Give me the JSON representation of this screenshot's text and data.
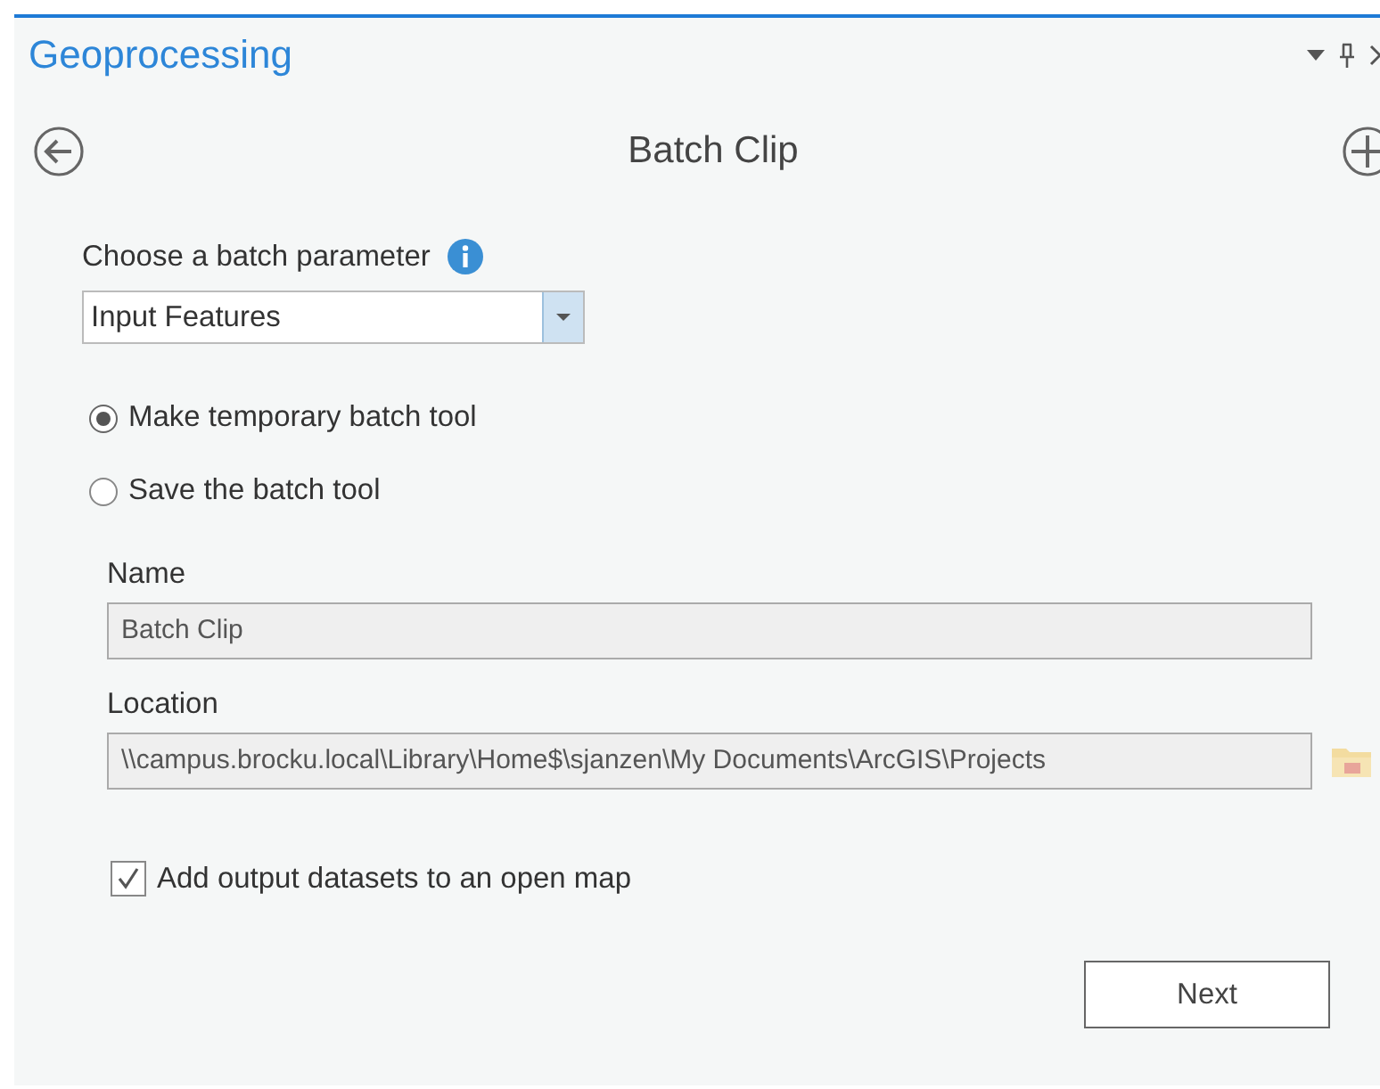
{
  "pane": {
    "title": "Geoprocessing"
  },
  "tool": {
    "title": "Batch Clip"
  },
  "batch_parameter": {
    "label": "Choose a batch parameter",
    "value": "Input Features"
  },
  "tool_options": [
    {
      "label": "Make temporary batch tool",
      "selected": true
    },
    {
      "label": "Save the batch tool",
      "selected": false
    }
  ],
  "fields": [
    {
      "label": "Name",
      "value": "Batch Clip",
      "disabled": true,
      "browse": false
    },
    {
      "label": "Location",
      "value": "\\\\campus.brocku.local\\Library\\Home$\\sjanzen\\My Documents\\ArcGIS\\Projects",
      "disabled": true,
      "browse": true
    }
  ],
  "add_to_map": {
    "label": "Add output datasets to an open map",
    "checked": true
  },
  "buttons": [
    "Next"
  ]
}
